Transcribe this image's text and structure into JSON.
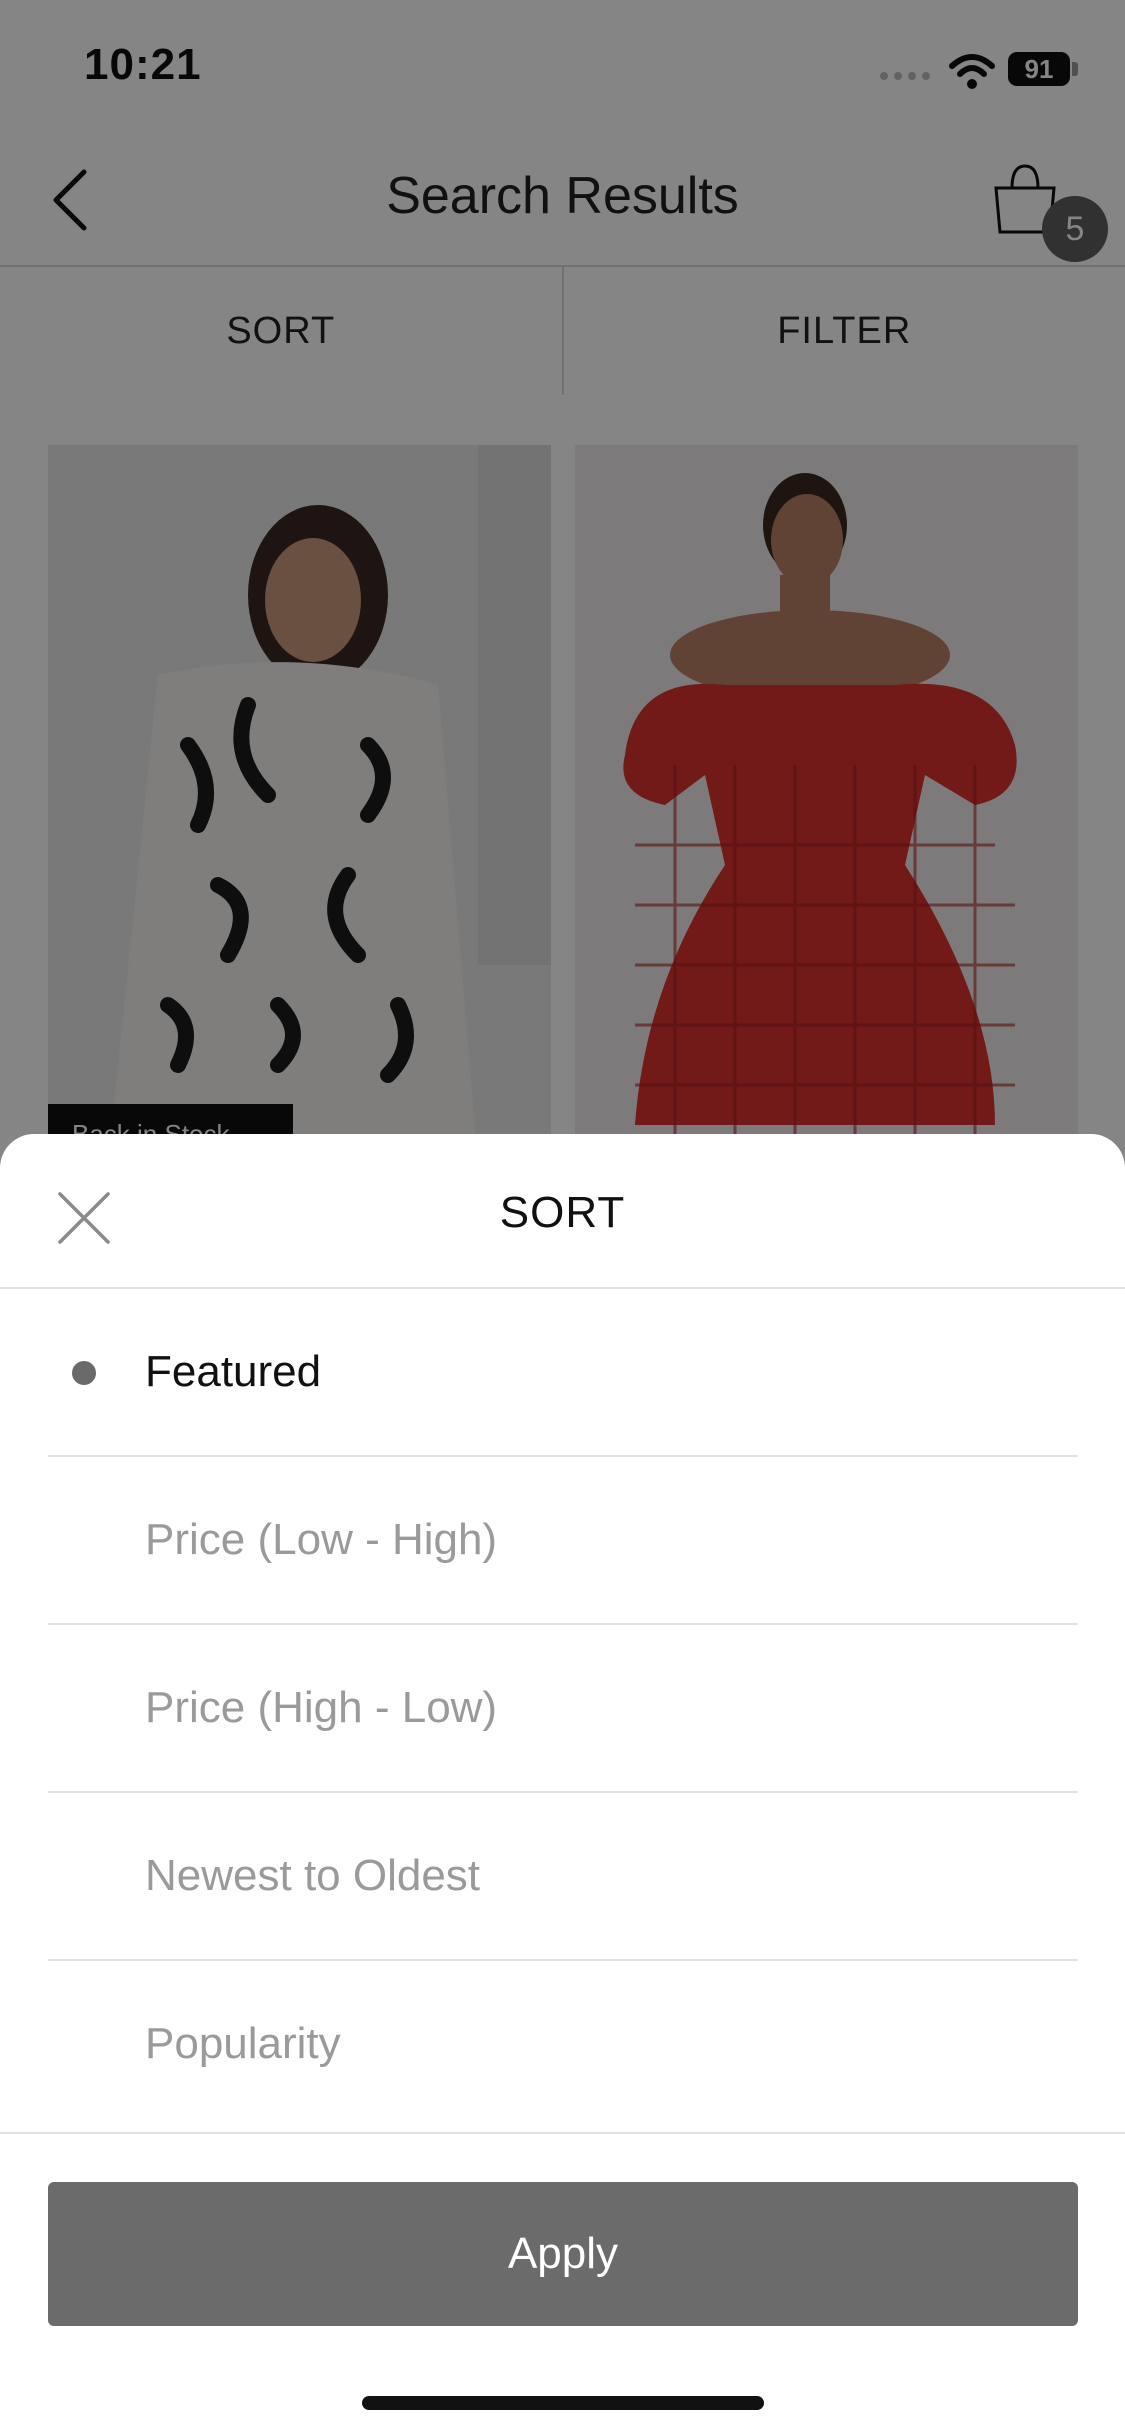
{
  "status_bar": {
    "time": "10:21",
    "battery": "91"
  },
  "nav": {
    "title": "Search Results",
    "cart_count": "5"
  },
  "toolbar": {
    "sort_label": "SORT",
    "filter_label": "FILTER"
  },
  "products": [
    {
      "tag": "Back in Stock"
    },
    {
      "tag": ""
    }
  ],
  "sort_sheet": {
    "title": "SORT",
    "options": [
      {
        "label": "Featured",
        "selected": true
      },
      {
        "label": "Price (Low - High)",
        "selected": false
      },
      {
        "label": "Price (High - Low)",
        "selected": false
      },
      {
        "label": "Newest to Oldest",
        "selected": false
      },
      {
        "label": "Popularity",
        "selected": false
      }
    ],
    "apply_label": "Apply"
  },
  "colors": {
    "overlay": "#000000",
    "apply_button": "#6b6b6b",
    "badge": "#5f5f5f"
  }
}
